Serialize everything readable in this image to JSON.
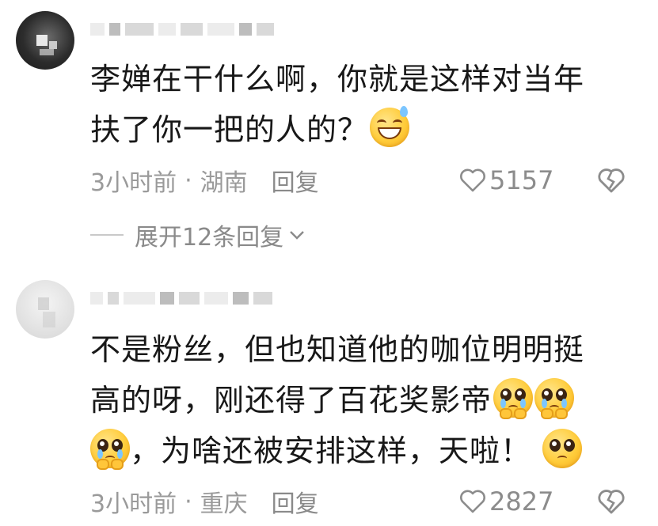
{
  "comments": [
    {
      "text_lines": [
        "李婵在干什么啊，你就是这样对当年",
        "扶了你一把的人的？"
      ],
      "emoji": "grinning-sweat-emoji",
      "time": "3小时前",
      "sep": "·",
      "location": "湖南",
      "reply_label": "回复",
      "likes": "5157",
      "expand_label": "展开12条回复"
    },
    {
      "text_lines": [
        "不是粉丝，但也知道他的咖位明明挺",
        "高的呀，刚还得了百花奖影帝",
        "，为啥还被安排这样，天啦！"
      ],
      "emoji": "pleading-face-emoji",
      "time": "3小时前",
      "sep": "·",
      "location": "重庆",
      "reply_label": "回复",
      "likes": "2827"
    }
  ],
  "colors": {
    "text": "#181818",
    "meta": "#9a9a9a",
    "icon": "#8c8c8c",
    "background": "#ffffff"
  },
  "icons": [
    "heart-outline-icon",
    "broken-heart-icon",
    "chevron-down-icon"
  ]
}
